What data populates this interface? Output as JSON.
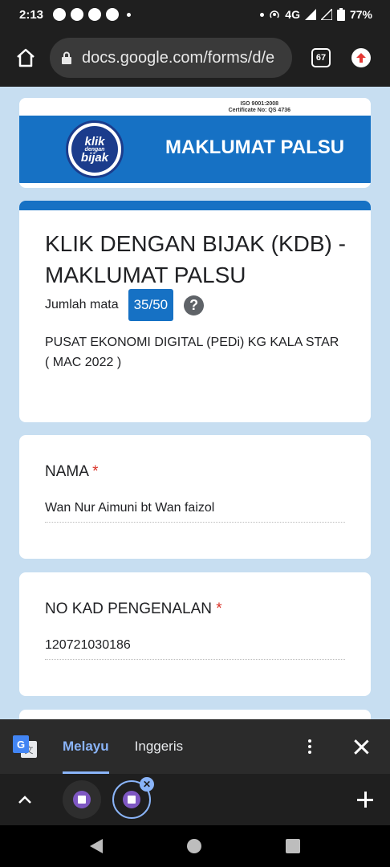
{
  "status_bar": {
    "time": "2:13",
    "network": "4G",
    "battery": "77%"
  },
  "browser": {
    "url": "docs.google.com/forms/d/e",
    "tab_count": "67"
  },
  "banner": {
    "iso_line1": "ISO 9001:2008",
    "iso_line2": "Certificate No: QS 4736",
    "logo_line1": "klik",
    "logo_line2": "dengan",
    "logo_line3": "bijak",
    "title": "MAKLUMAT PALSU"
  },
  "form": {
    "title": "KLIK DENGAN BIJAK (KDB) - MAKLUMAT PALSU",
    "score_label": "Jumlah mata",
    "score_value": "35/50",
    "help": "?",
    "description_line1": "PUSAT EKONOMI DIGITAL (PEDi) KG KALA STAR",
    "description_line2": "( MAC 2022 )",
    "questions": [
      {
        "label": "NAMA",
        "required_mark": "*",
        "answer": "Wan Nur Aimuni bt Wan faizol"
      },
      {
        "label": "NO KAD PENGENALAN",
        "required_mark": "*",
        "answer": "120721030186"
      }
    ]
  },
  "translate_bar": {
    "active_lang": "Melayu",
    "other_lang": "Inggeris"
  },
  "colors": {
    "accent": "#1671c4",
    "page_bg": "#c7def1",
    "required": "#d93025"
  }
}
